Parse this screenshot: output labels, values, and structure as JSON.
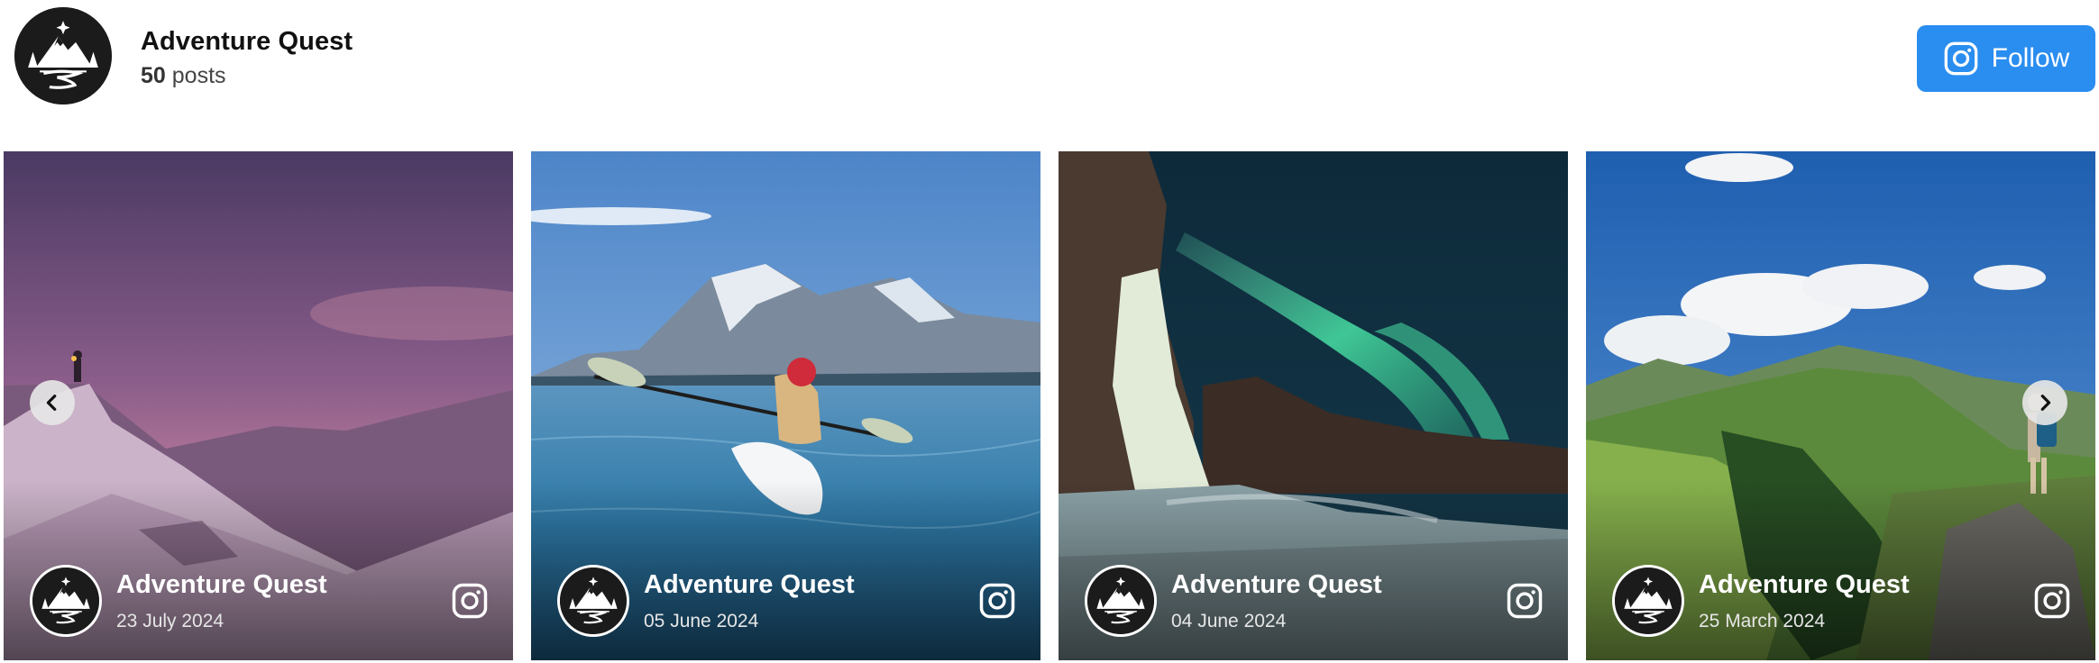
{
  "profile": {
    "name": "Adventure Quest",
    "post_count": "50",
    "posts_label": "posts",
    "follow_label": "Follow",
    "avatar_icon": "mountain-logo-icon"
  },
  "colors": {
    "follow_button": "#2a8df0",
    "text_primary": "#111111"
  },
  "posts": [
    {
      "author": "Adventure Quest",
      "date": "23 July 2024",
      "scene": "purple-dusk-snow-mountain"
    },
    {
      "author": "Adventure Quest",
      "date": "05 June 2024",
      "scene": "kayak-lake-mountain"
    },
    {
      "author": "Adventure Quest",
      "date": "04 June 2024",
      "scene": "aurora-ice-waterfall"
    },
    {
      "author": "Adventure Quest",
      "date": "25 March 2024",
      "scene": "green-mountains-hiker"
    }
  ],
  "navigation": {
    "prev_icon": "chevron-left-icon",
    "next_icon": "chevron-right-icon"
  }
}
